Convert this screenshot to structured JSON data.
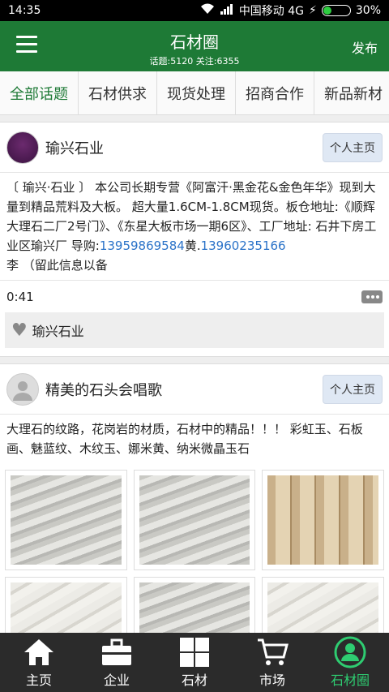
{
  "status": {
    "time": "14:35",
    "carrier": "中国移动 4G",
    "battery": "30%",
    "battery_level": 0.3
  },
  "header": {
    "title": "石材圈",
    "subtitle": "话题:5120 关注:6355",
    "publish": "发布"
  },
  "tabs": [
    "全部话题",
    "石材供求",
    "现货处理",
    "招商合作",
    "新品新材"
  ],
  "posts": [
    {
      "name": "瑜兴石业",
      "homepage": "个人主页",
      "text_pre": "〔 瑜兴·石业 〕 本公司长期专营《阿富汗·黑金花&金色年华》现到大量到精品荒料及大板。 超大量1.6CM-1.8CM现货。板仓地址:《顺辉大理石二厂2号门》、《东星大板市场一期6区》、工厂地址: 石井下房工业区瑜兴厂 导购:",
      "phone1": "13959869584",
      "mid": "黄.",
      "phone2": "13960235166",
      "text_post": "李 （留此信息以备",
      "duration": "0:41",
      "like_name": "瑜兴石业"
    },
    {
      "name": "精美的石头会唱歌",
      "homepage": "个人主页",
      "text": "大理石的纹路，花岗岩的材质，石材中的精品！！！ 彩虹玉、石板画、魅蓝纹、木纹玉、娜米黄、纳米微晶玉石"
    }
  ],
  "nav": [
    {
      "label": "主页",
      "icon": "home-icon"
    },
    {
      "label": "企业",
      "icon": "briefcase-icon"
    },
    {
      "label": "石材",
      "icon": "grid-icon"
    },
    {
      "label": "市场",
      "icon": "cart-icon"
    },
    {
      "label": "石材圈",
      "icon": "person-circle-icon"
    }
  ],
  "colors": {
    "brand": "#1e7a36",
    "active_nav": "#2ecc71",
    "link": "#2a72c8"
  }
}
